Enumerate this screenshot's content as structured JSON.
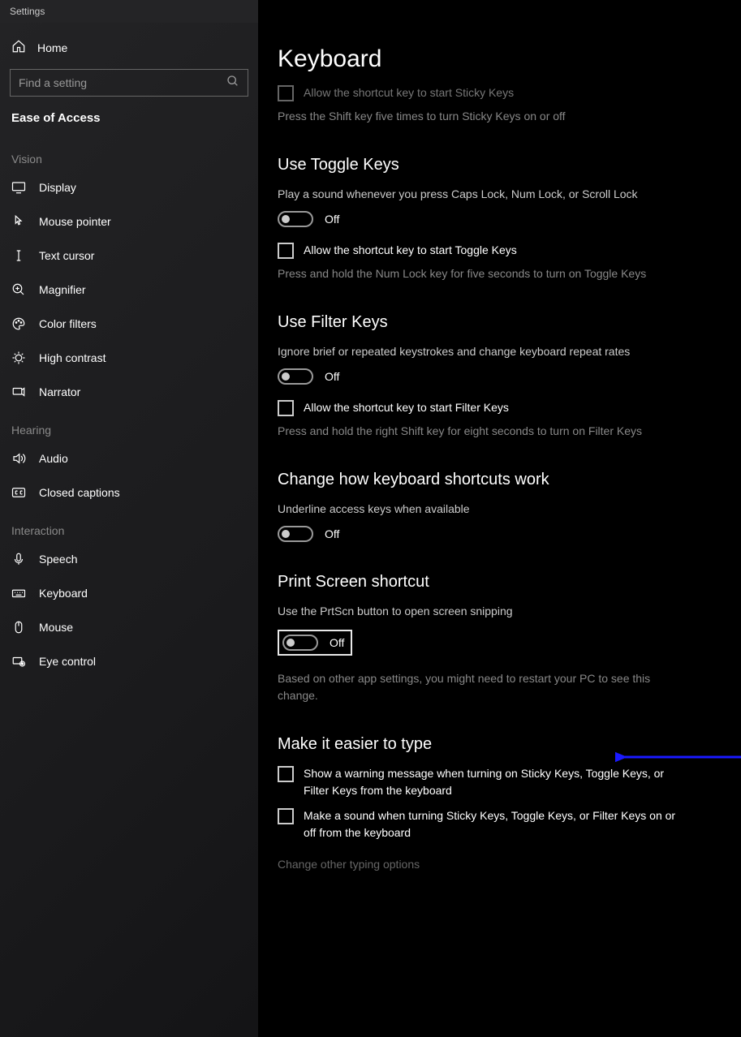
{
  "window_title": "Settings",
  "sidebar": {
    "home": "Home",
    "search_placeholder": "Find a setting",
    "current_category": "Ease of Access",
    "groups": [
      {
        "label": "Vision",
        "items": [
          {
            "id": "display",
            "label": "Display",
            "icon": "monitor-icon"
          },
          {
            "id": "mouse-pointer",
            "label": "Mouse pointer",
            "icon": "pointer-icon"
          },
          {
            "id": "text-cursor",
            "label": "Text cursor",
            "icon": "cursor-icon"
          },
          {
            "id": "magnifier",
            "label": "Magnifier",
            "icon": "magnifier-icon"
          },
          {
            "id": "color-filters",
            "label": "Color filters",
            "icon": "palette-icon"
          },
          {
            "id": "high-contrast",
            "label": "High contrast",
            "icon": "contrast-icon"
          },
          {
            "id": "narrator",
            "label": "Narrator",
            "icon": "narrator-icon"
          }
        ]
      },
      {
        "label": "Hearing",
        "items": [
          {
            "id": "audio",
            "label": "Audio",
            "icon": "speaker-icon"
          },
          {
            "id": "closed-captions",
            "label": "Closed captions",
            "icon": "cc-icon"
          }
        ]
      },
      {
        "label": "Interaction",
        "items": [
          {
            "id": "speech",
            "label": "Speech",
            "icon": "mic-icon"
          },
          {
            "id": "keyboard",
            "label": "Keyboard",
            "icon": "keyboard-icon"
          },
          {
            "id": "mouse",
            "label": "Mouse",
            "icon": "mouse-icon"
          },
          {
            "id": "eye-control",
            "label": "Eye control",
            "icon": "eye-icon"
          }
        ]
      }
    ]
  },
  "page": {
    "title": "Keyboard",
    "sticky_partial": {
      "checkbox_label": "Allow the shortcut key to start Sticky Keys",
      "hint": "Press the Shift key five times to turn Sticky Keys on or off"
    },
    "toggle_keys": {
      "heading": "Use Toggle Keys",
      "desc": "Play a sound whenever you press Caps Lock, Num Lock, or Scroll Lock",
      "state": "Off",
      "checkbox_label": "Allow the shortcut key to start Toggle Keys",
      "hint": "Press and hold the Num Lock key for five seconds to turn on Toggle Keys"
    },
    "filter_keys": {
      "heading": "Use Filter Keys",
      "desc": "Ignore brief or repeated keystrokes and change keyboard repeat rates",
      "state": "Off",
      "checkbox_label": "Allow the shortcut key to start Filter Keys",
      "hint": "Press and hold the right Shift key for eight seconds to turn on Filter Keys"
    },
    "shortcuts": {
      "heading": "Change how keyboard shortcuts work",
      "desc": "Underline access keys when available",
      "state": "Off"
    },
    "prtscn": {
      "heading": "Print Screen shortcut",
      "desc": "Use the PrtScn button to open screen snipping",
      "state": "Off",
      "hint": "Based on other app settings, you might need to restart your PC to see this change."
    },
    "easier": {
      "heading": "Make it easier to type",
      "cb1": "Show a warning message when turning on Sticky Keys, Toggle Keys, or Filter Keys from the keyboard",
      "cb2": "Make a sound when turning Sticky Keys, Toggle Keys, or Filter Keys on or off from the keyboard",
      "link": "Change other typing options"
    }
  }
}
